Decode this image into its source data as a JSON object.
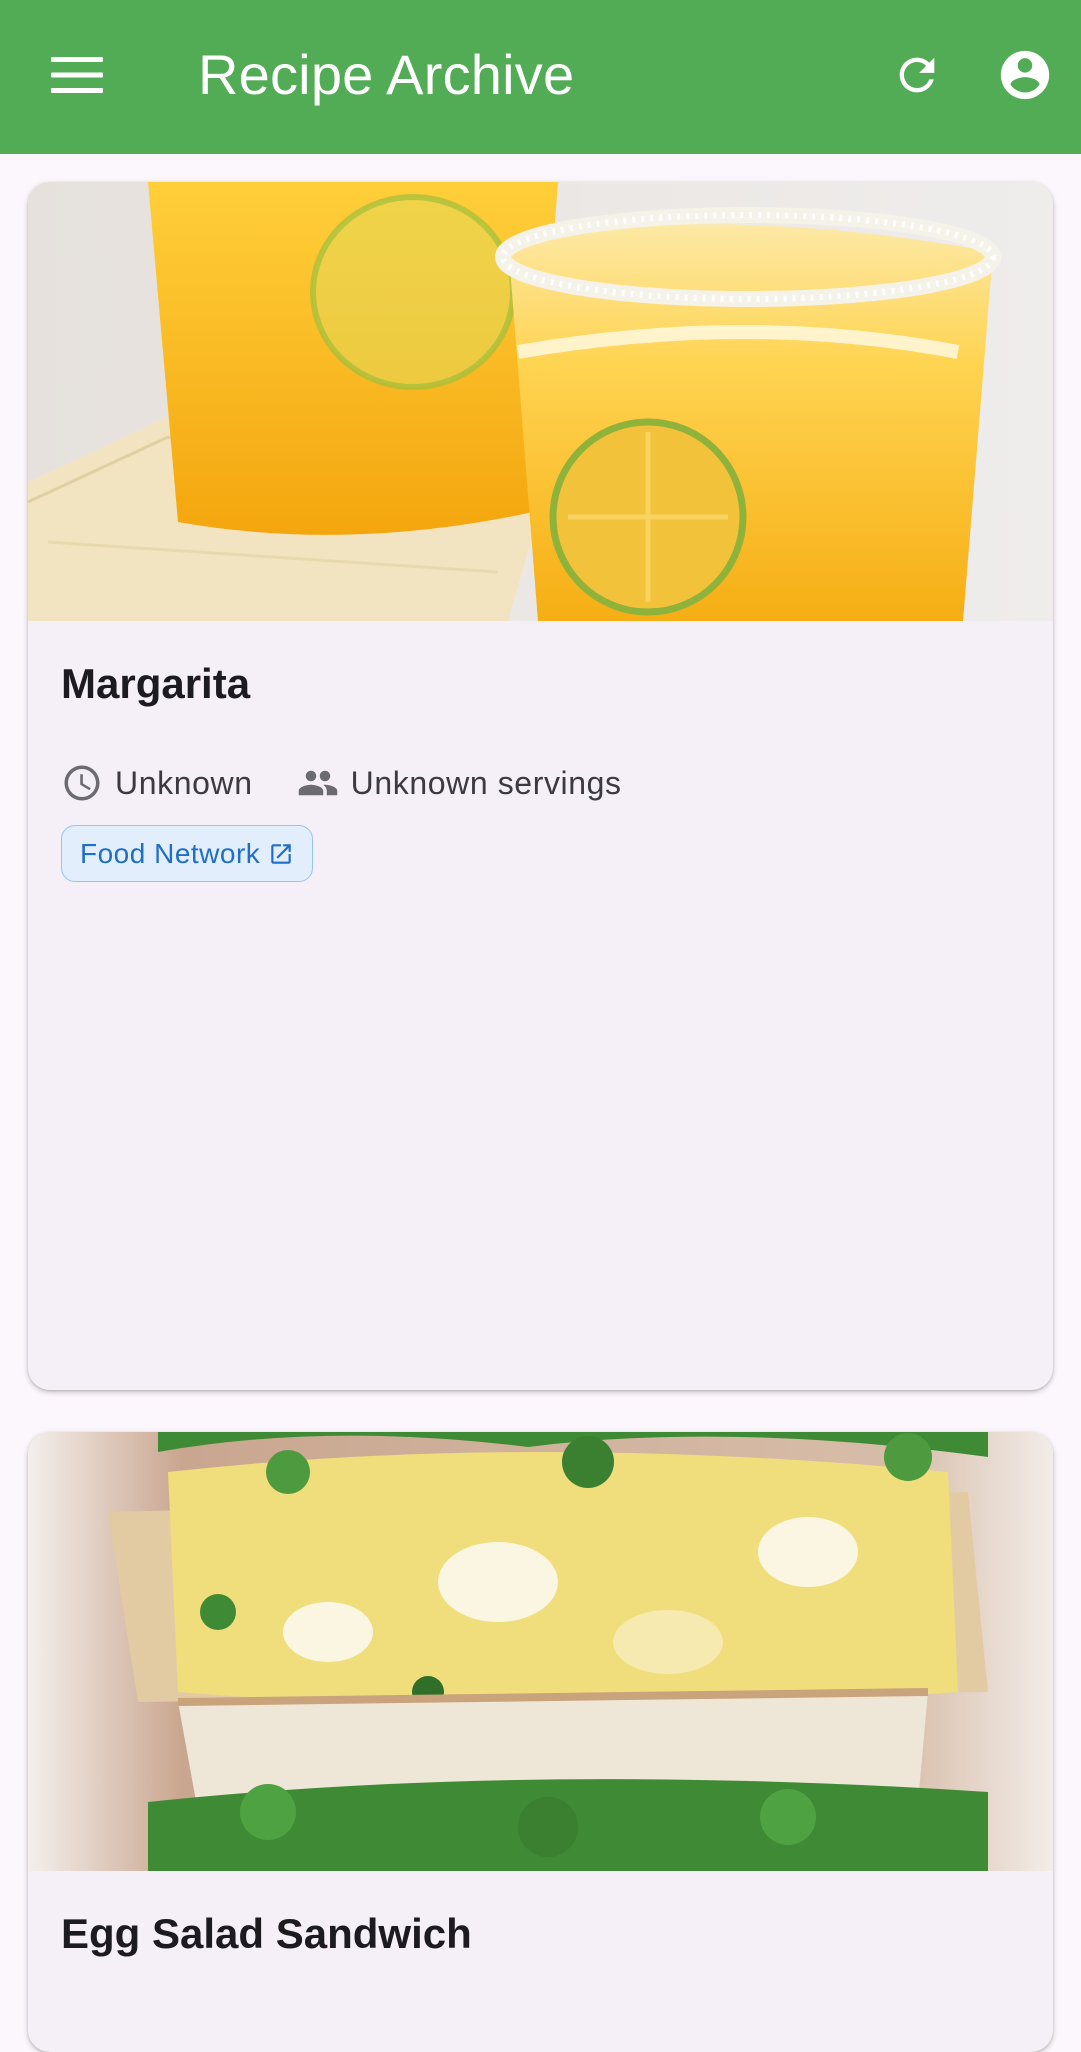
{
  "app_bar": {
    "title": "Recipe Archive",
    "background": "#52ab55",
    "icons": {
      "menu": "menu-icon",
      "refresh": "refresh-icon",
      "account": "account-circle-icon"
    }
  },
  "recipes": [
    {
      "title": "Margarita",
      "time": "Unknown",
      "servings": "Unknown servings",
      "source_label": "Food Network",
      "image_alt": "margarita-photo"
    },
    {
      "title": "Egg Salad Sandwich",
      "image_alt": "egg-salad-sandwich-photo"
    }
  ],
  "colors": {
    "background": "#fcf7fc",
    "card": "#f5eff7",
    "chip_text": "#1f6fc5",
    "chip_border": "#97c4ef",
    "chip_fill": "#e2eefb"
  }
}
